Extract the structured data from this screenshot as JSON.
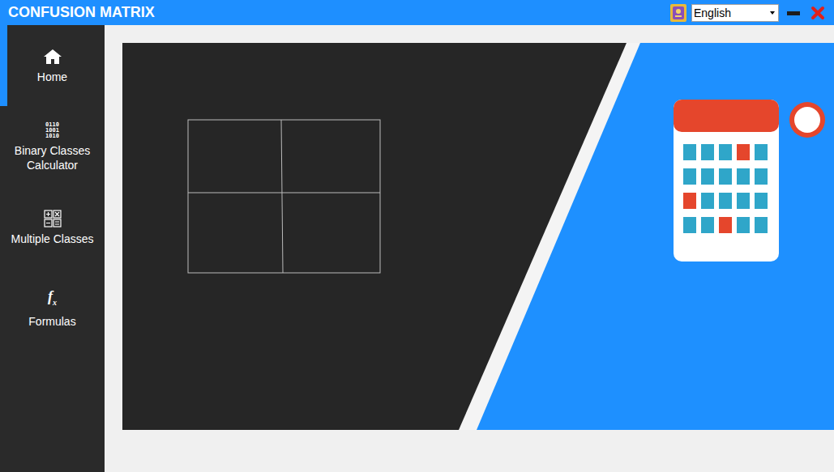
{
  "window": {
    "title": "CONFUSION MATRIX"
  },
  "language": {
    "value": "English"
  },
  "sidebar": {
    "items": [
      {
        "label": "Home",
        "kind": "home",
        "icon_text": [],
        "selected": true
      },
      {
        "label": "Binary Classes Calculator",
        "kind": "digits",
        "icon_text": [
          "0110",
          "1001",
          "1010"
        ],
        "selected": false
      },
      {
        "label": "Multiple Classes",
        "kind": "grid",
        "icon_text": [],
        "selected": false
      },
      {
        "label": "Formulas",
        "kind": "formula",
        "icon_text": [
          "f",
          "x"
        ],
        "selected": false
      }
    ]
  }
}
